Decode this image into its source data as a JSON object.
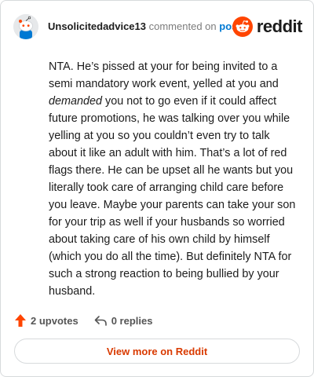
{
  "comment": {
    "username": "Unsolicitedadvice13",
    "action_text": "commented on",
    "post_link_text": "post",
    "avatar_icon": "snoo-avatar-icon",
    "body": {
      "part1": "NTA. He’s pissed at your for being invited to a semi mandatory work event, yelled at you and ",
      "emphasis": "demanded",
      "part2": " you not to go even if it could affect future promotions, he was talking over you while yelling at you so you couldn’t even try to talk about it like an adult with him. That’s a lot of red flags there. He can be upset all he wants but you literally took care of arranging child care before you leave. Maybe your parents can take your son for your trip as well if your husbands so worried about taking care of his own child by himself (which you do all the time). But definitely NTA for such a strong reaction to being bullied by your husband."
    }
  },
  "brand": {
    "wordmark": "reddit",
    "icon": "reddit-logo-icon",
    "color": "#ff4500"
  },
  "actions": {
    "upvotes_label": "2 upvotes",
    "upvote_icon": "upvote-arrow-icon",
    "upvote_color": "#ff4500",
    "replies_label": "0 replies",
    "reply_icon": "reply-arrow-icon"
  },
  "footer": {
    "view_more_label": "View more on Reddit",
    "view_more_color": "#d93a00"
  }
}
